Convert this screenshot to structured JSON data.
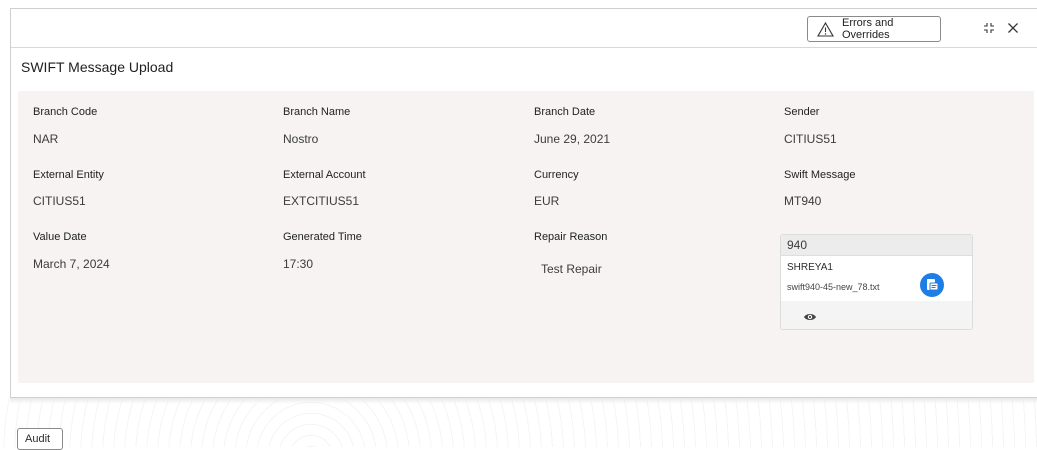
{
  "toolbar": {
    "errors_label": "Errors and Overrides",
    "errors_icon": "warning-triangle-icon",
    "collapse_icon": "collapse-icon",
    "close_icon": "close-icon"
  },
  "page": {
    "title": "SWIFT Message Upload"
  },
  "fields": {
    "branch_code": {
      "label": "Branch Code",
      "value": "NAR"
    },
    "branch_name": {
      "label": "Branch Name",
      "value": "Nostro"
    },
    "branch_date": {
      "label": "Branch Date",
      "value": "June 29, 2021"
    },
    "sender": {
      "label": "Sender",
      "value": "CITIUS51"
    },
    "external_entity": {
      "label": "External Entity",
      "value": "CITIUS51"
    },
    "external_account": {
      "label": "External Account",
      "value": "EXTCITIUS51"
    },
    "currency": {
      "label": "Currency",
      "value": "EUR"
    },
    "swift_message": {
      "label": "Swift Message",
      "value": "MT940"
    },
    "value_date": {
      "label": "Value Date",
      "value": "March 7, 2024"
    },
    "generated_time": {
      "label": "Generated Time",
      "value": "17:30"
    },
    "repair_reason": {
      "label": "Repair Reason",
      "value": "Test Repair"
    }
  },
  "attachment": {
    "header": "940",
    "user": "SHREYA1",
    "filename": "swift940-45-new_78.txt",
    "doc_icon": "document-icon",
    "view_icon": "eye-icon"
  },
  "footer": {
    "audit_label": "Audit"
  },
  "colors": {
    "accent": "#1f7de6",
    "panel_bg": "#f6f3f2"
  }
}
